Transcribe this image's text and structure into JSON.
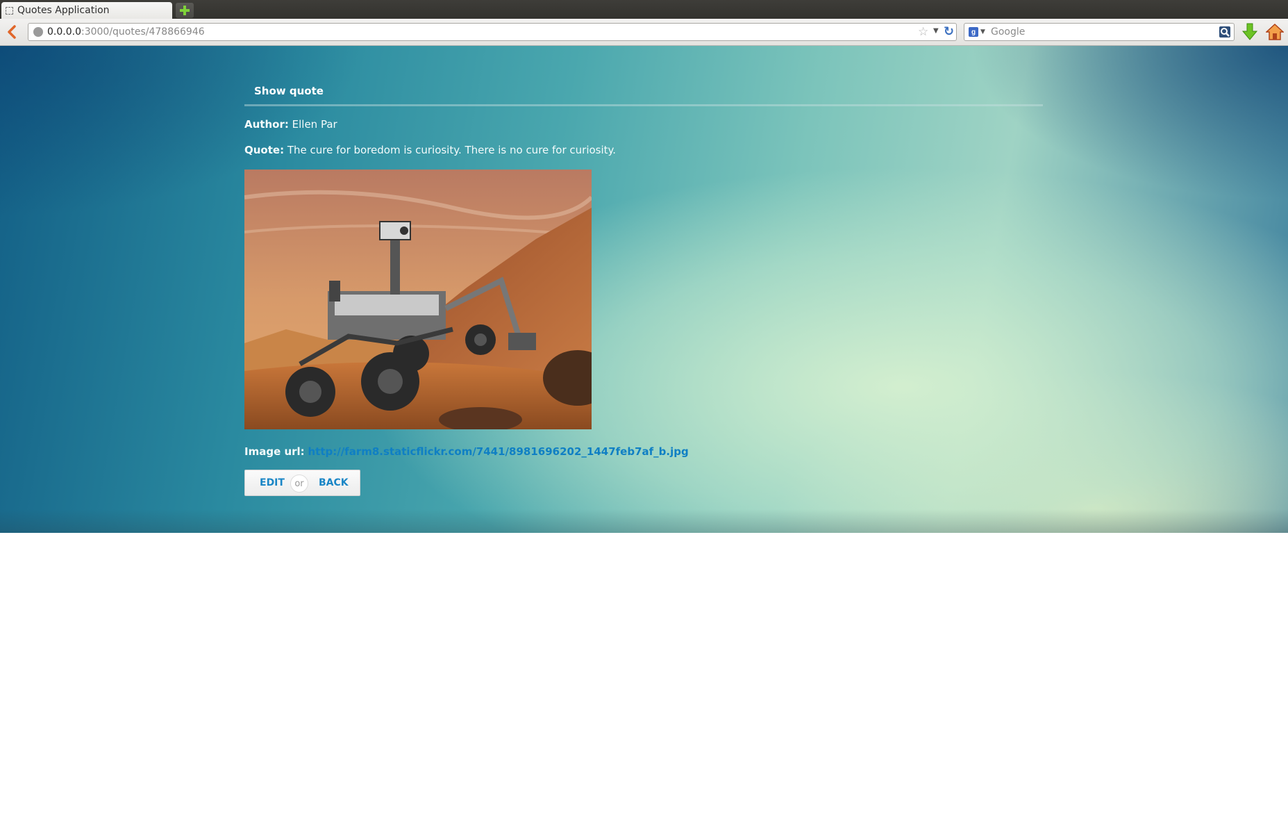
{
  "browser": {
    "tab_title": "Quotes Application",
    "url_host": "0.0.0.0",
    "url_path": ":3000/quotes/478866946",
    "search_engine": "Google",
    "search_placeholder": "Google"
  },
  "page": {
    "heading": "Show quote",
    "author_label": "Author:",
    "author_value": "Ellen Par",
    "quote_label": "Quote:",
    "quote_value": "The cure for boredom is curiosity. There is no cure for curiosity.",
    "image_description": "mars-rover-photo",
    "image_url_label": "Image url:",
    "image_url_value": "http://farm8.staticflickr.com/7441/8981696202_1447feb7af_b.jpg",
    "actions": {
      "edit": "EDIT",
      "or": "or",
      "back": "BACK"
    }
  },
  "colors": {
    "link": "#0f7fc4",
    "action_link": "#1a86c6",
    "background_dark": "#135f86",
    "background_light": "#d6f0d0"
  }
}
